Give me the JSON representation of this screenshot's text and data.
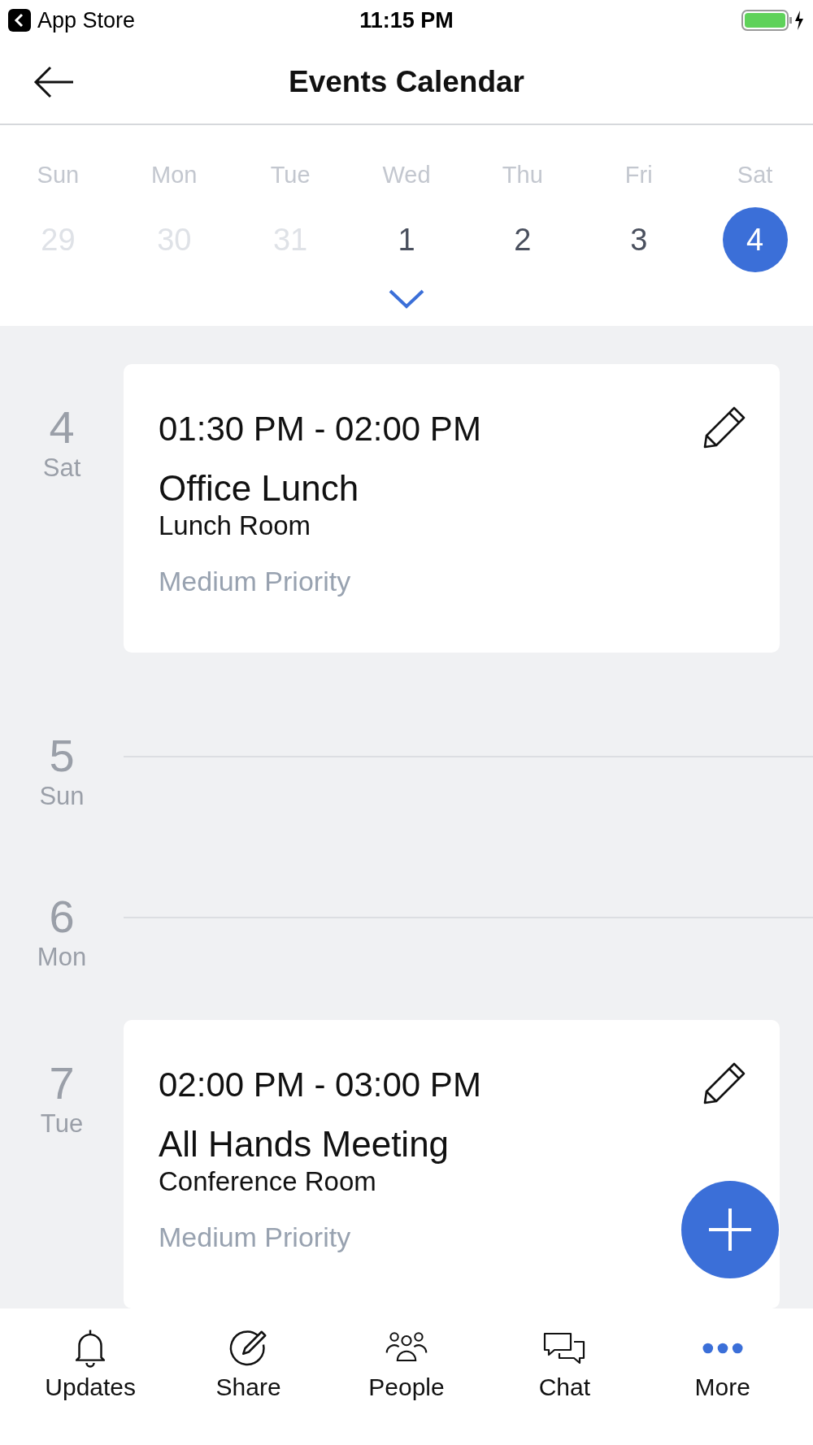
{
  "status_bar": {
    "back_label": "App Store",
    "time": "11:15 PM"
  },
  "header": {
    "title": "Events Calendar"
  },
  "week": [
    {
      "weekday": "Sun",
      "date": "29",
      "outside_month": true,
      "selected": false
    },
    {
      "weekday": "Mon",
      "date": "30",
      "outside_month": true,
      "selected": false
    },
    {
      "weekday": "Tue",
      "date": "31",
      "outside_month": true,
      "selected": false
    },
    {
      "weekday": "Wed",
      "date": "1",
      "outside_month": false,
      "selected": false
    },
    {
      "weekday": "Thu",
      "date": "2",
      "outside_month": false,
      "selected": false
    },
    {
      "weekday": "Fri",
      "date": "3",
      "outside_month": false,
      "selected": false
    },
    {
      "weekday": "Sat",
      "date": "4",
      "outside_month": false,
      "selected": true
    }
  ],
  "agenda": [
    {
      "date": "4",
      "weekday": "Sat",
      "events": [
        {
          "time": "01:30 PM - 02:00 PM",
          "title": "Office Lunch",
          "location": "Lunch Room",
          "priority": "Medium Priority"
        }
      ]
    },
    {
      "date": "5",
      "weekday": "Sun"
    },
    {
      "date": "6",
      "weekday": "Mon"
    },
    {
      "date": "7",
      "weekday": "Tue",
      "events": [
        {
          "time": "02:00 PM - 03:00 PM",
          "title": "All Hands Meeting",
          "location": "Conference Room",
          "priority": "Medium Priority"
        }
      ]
    }
  ],
  "tab_bar": [
    {
      "kind": "bell",
      "label": "Updates",
      "selected": false
    },
    {
      "kind": "compose",
      "label": "Share",
      "selected": false
    },
    {
      "kind": "people",
      "label": "People",
      "selected": false
    },
    {
      "kind": "chat",
      "label": "Chat",
      "selected": false
    },
    {
      "kind": "more",
      "label": "More",
      "selected": true
    }
  ]
}
